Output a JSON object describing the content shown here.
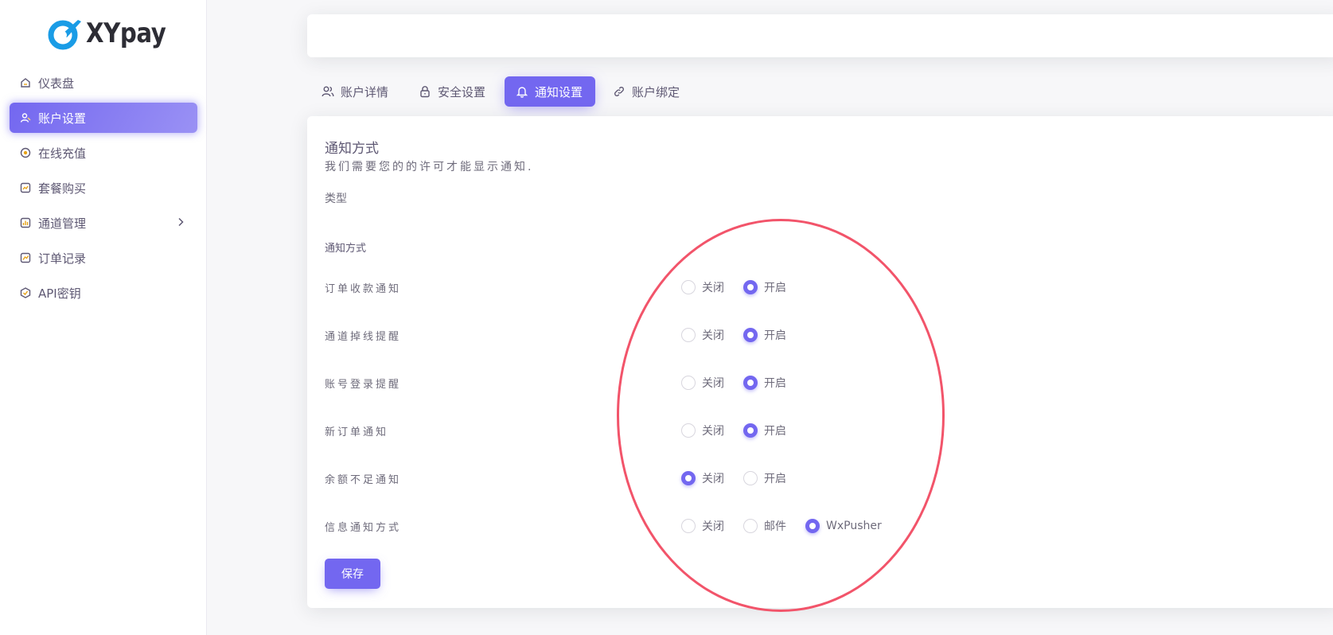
{
  "brand": {
    "name": "XYpay",
    "accent": "#7367f0",
    "logo_color": "#1a9ce6"
  },
  "sidebar": {
    "items": [
      {
        "label": "仪表盘",
        "icon": "home-icon",
        "active": false
      },
      {
        "label": "账户设置",
        "icon": "user-edit-icon",
        "active": true
      },
      {
        "label": "在线充值",
        "icon": "coin-icon",
        "active": false
      },
      {
        "label": "套餐购买",
        "icon": "package-icon",
        "active": false
      },
      {
        "label": "通道管理",
        "icon": "bar-chart-icon",
        "active": false,
        "has_submenu": true
      },
      {
        "label": "订单记录",
        "icon": "trend-chart-icon",
        "active": false
      },
      {
        "label": "API密钥",
        "icon": "key-badge-icon",
        "active": false
      }
    ]
  },
  "tabs": [
    {
      "label": "账户详情",
      "icon": "users-icon",
      "active": false
    },
    {
      "label": "安全设置",
      "icon": "lock-icon",
      "active": false
    },
    {
      "label": "通知设置",
      "icon": "bell-icon",
      "active": true
    },
    {
      "label": "账户绑定",
      "icon": "link-icon",
      "active": false
    }
  ],
  "card": {
    "title": "通知方式",
    "subtitle": "我们需要您的的许可才能显示通知.",
    "type_label": "类型",
    "section_label": "通知方式",
    "rows": [
      {
        "label": "订单收款通知",
        "options": [
          "关闭",
          "开启"
        ],
        "selected": 1
      },
      {
        "label": "通道掉线提醒",
        "options": [
          "关闭",
          "开启"
        ],
        "selected": 1
      },
      {
        "label": "账号登录提醒",
        "options": [
          "关闭",
          "开启"
        ],
        "selected": 1
      },
      {
        "label": "新订单通知",
        "options": [
          "关闭",
          "开启"
        ],
        "selected": 1
      },
      {
        "label": "余额不足通知",
        "options": [
          "关闭",
          "开启"
        ],
        "selected": 0
      },
      {
        "label": "信息通知方式",
        "options": [
          "关闭",
          "邮件",
          "WxPusher"
        ],
        "selected": 2
      }
    ],
    "save_label": "保存"
  },
  "annotation": {
    "color": "#f2546a"
  }
}
